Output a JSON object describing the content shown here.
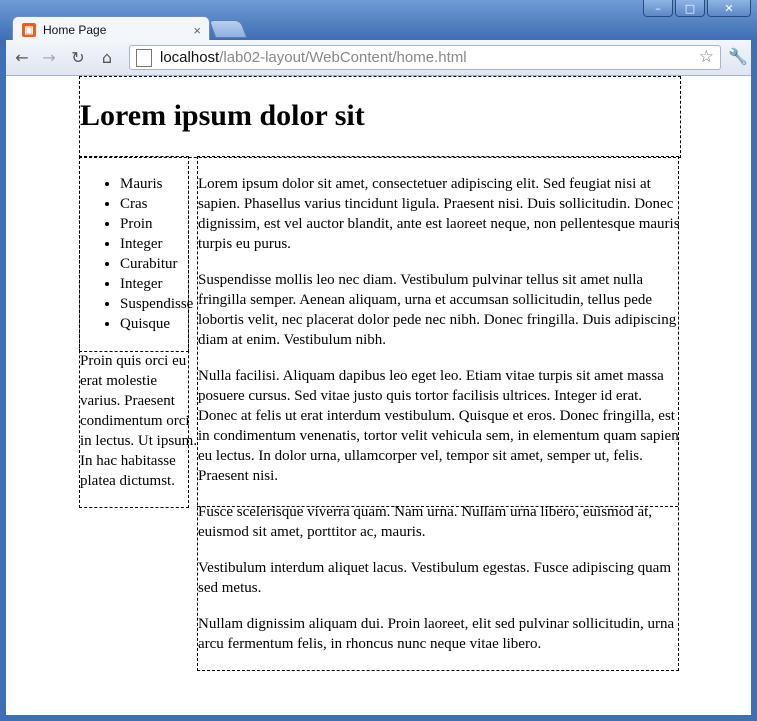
{
  "browser": {
    "tab_title": "Home Page",
    "url_host": "localhost",
    "url_path": "/lab02-layout/WebContent/home.html"
  },
  "page": {
    "heading": "Lorem ipsum dolor sit",
    "nav_items": [
      "Mauris",
      "Cras",
      "Proin",
      "Integer",
      "Curabitur",
      "Integer",
      "Suspendisse",
      "Quisque"
    ],
    "sidebar_text": "Proin quis orci eu erat molestie varius. Praesent condimentum orci in lectus. Ut ipsum. In hac habitasse platea dictumst.",
    "paragraphs": [
      "Lorem ipsum dolor sit amet, consectetuer adipiscing elit. Sed feugiat nisi at sapien. Phasellus varius tincidunt ligula. Praesent nisi. Duis sollicitudin. Donec dignissim, est vel auctor blandit, ante est laoreet neque, non pellentesque mauris turpis eu purus.",
      "Suspendisse mollis leo nec diam. Vestibulum pulvinar tellus sit amet nulla fringilla semper. Aenean aliquam, urna et accumsan sollicitudin, tellus pede lobortis velit, nec placerat dolor pede nec nibh. Donec fringilla. Duis adipiscing diam at enim. Vestibulum nibh.",
      "Nulla facilisi. Aliquam dapibus leo eget leo. Etiam vitae turpis sit amet massa posuere cursus. Sed vitae justo quis tortor facilisis ultrices. Integer id erat. Donec at felis ut erat interdum vestibulum. Quisque et eros. Donec fringilla, est in condimentum venenatis, tortor velit vehicula sem, in elementum quam sapien eu lectus. In dolor urna, ullamcorper vel, tempor sit amet, semper ut, felis. Praesent nisi.",
      "Fusce scelerisque viverra quam. Nam urna. Nullam urna libero, euismod at, euismod sit amet, porttitor ac, mauris.",
      "Vestibulum interdum aliquet lacus. Vestibulum egestas. Fusce adipiscing quam sed metus.",
      "Nullam dignissim aliquam dui. Proin laoreet, elit sed pulvinar sollicitudin, urna arcu fermentum felis, in rhoncus nunc neque vitae libero."
    ]
  }
}
